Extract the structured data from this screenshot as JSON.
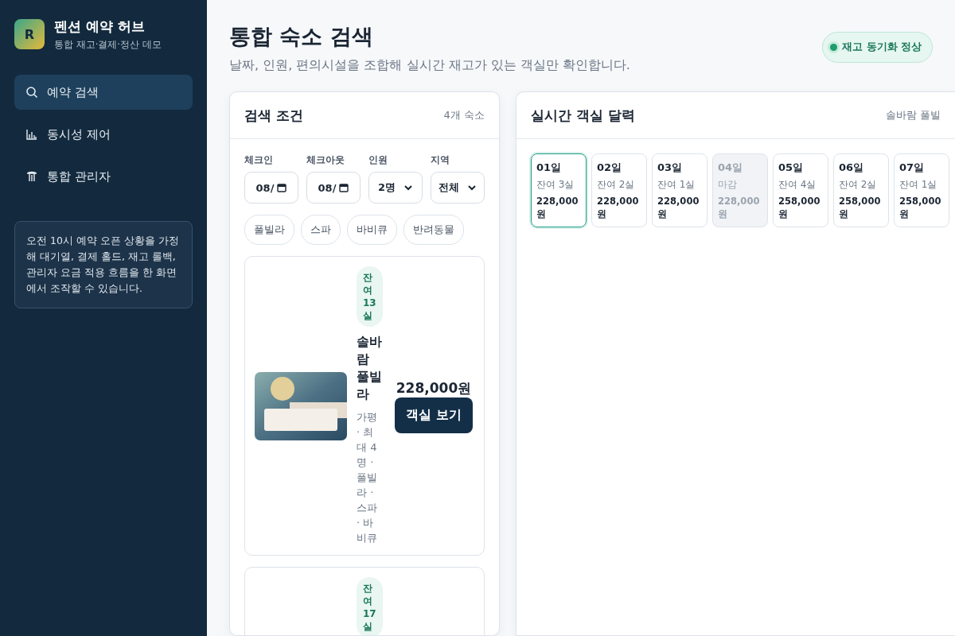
{
  "brand": {
    "logo": "R",
    "title": "펜션 예약 허브",
    "subtitle": "통합 재고·결제·정산 데모"
  },
  "nav": [
    {
      "label": "예약 검색",
      "selected": true
    },
    {
      "label": "동시성 제어",
      "selected": false
    },
    {
      "label": "통합 관리자",
      "selected": false
    }
  ],
  "note": "오전 10시 예약 오픈 상황을 가정해 대기열, 결제 홀드, 재고 롤백, 관리자 요금 적용 흐름을 한 화면에서 조작할 수 있습니다.",
  "header": {
    "title": "통합 숙소 검색",
    "subtitle": "날짜, 인원, 편의시설을 조합해 실시간 재고가 있는 객실만 확인합니다.",
    "status": "재고 동기화 정상"
  },
  "search_panel": {
    "title": "검색 조건",
    "count": "4개 숙소",
    "fields": [
      {
        "label": "체크인",
        "kind": "date",
        "value": "08/"
      },
      {
        "label": "체크아웃",
        "kind": "date",
        "value": "08/"
      },
      {
        "label": "인원",
        "kind": "select",
        "value": "2명"
      },
      {
        "label": "지역",
        "kind": "select",
        "value": "전체"
      }
    ],
    "filters": [
      {
        "label": "풀빌라",
        "selected": false
      },
      {
        "label": "스파",
        "selected": false
      },
      {
        "label": "바비큐",
        "selected": false
      },
      {
        "label": "반려동물",
        "selected": false
      }
    ],
    "listings": [
      {
        "badge": "잔여 13실",
        "name": "솔바람 풀빌라",
        "meta": "가평 · 최대 4명 · 풀빌라 · 스파 · 바비큐",
        "price": "228,000원",
        "button": "객실 보기"
      },
      {
        "badge": "잔여 17실"
      }
    ]
  },
  "calendar_panel": {
    "title": "실시간 객실 달력",
    "property": "솔바람 풀빌",
    "days": [
      {
        "day": "01일",
        "status": "잔여 3실",
        "price": "228,000원",
        "selected": true,
        "disabled": false
      },
      {
        "day": "02일",
        "status": "잔여 2실",
        "price": "228,000원",
        "selected": false,
        "disabled": false
      },
      {
        "day": "03일",
        "status": "잔여 1실",
        "price": "228,000원",
        "selected": false,
        "disabled": false
      },
      {
        "day": "04일",
        "status": "마감",
        "price": "228,000원",
        "selected": false,
        "disabled": true
      },
      {
        "day": "05일",
        "status": "잔여 4실",
        "price": "258,000원",
        "selected": false,
        "disabled": false
      },
      {
        "day": "06일",
        "status": "잔여 2실",
        "price": "258,000원",
        "selected": false,
        "disabled": false
      },
      {
        "day": "07일",
        "status": "잔여 1실",
        "price": "258,000원",
        "selected": false,
        "disabled": false
      }
    ]
  }
}
